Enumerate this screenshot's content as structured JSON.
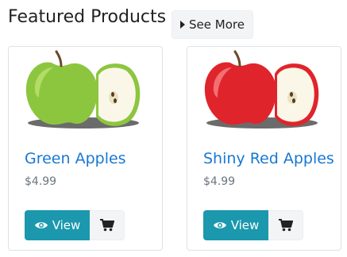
{
  "header": {
    "title": "Featured Products",
    "see_more_label": "See More"
  },
  "products": [
    {
      "name": "Green Apples",
      "price": "$4.99",
      "view_label": "View",
      "image": "green-apple-image"
    },
    {
      "name": "Shiny Red Apples",
      "price": "$4.99",
      "view_label": "View",
      "image": "red-apple-image"
    }
  ],
  "colors": {
    "link": "#1878d3",
    "view_button": "#1b98ad",
    "green_apple": "#8cc63f",
    "red_apple": "#e0242b"
  }
}
